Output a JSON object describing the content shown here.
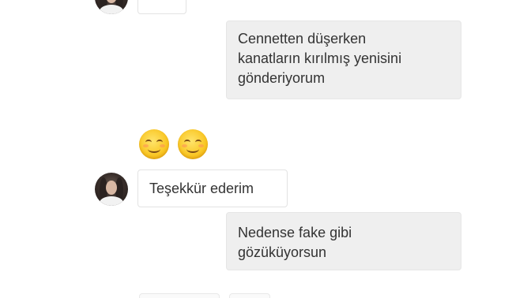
{
  "conversation": {
    "messages": [
      {
        "direction": "incoming",
        "text": "..."
      },
      {
        "direction": "outgoing",
        "lines": [
          "Cennetten düşerken",
          "kanatların kırılmış yenisini",
          "gönderiyorum"
        ]
      },
      {
        "direction": "reaction",
        "emojis": [
          "smiling-face-icon",
          "smiling-face-icon"
        ]
      },
      {
        "direction": "incoming",
        "text": "Teşekkür ederim"
      },
      {
        "direction": "outgoing",
        "lines": [
          "Nedense fake gibi",
          "gözüküyorsun"
        ]
      }
    ]
  },
  "colors": {
    "outgoing_bubble": "#efefef",
    "incoming_bubble": "#ffffff",
    "text": "#333333",
    "emoji": "#f9c623"
  }
}
